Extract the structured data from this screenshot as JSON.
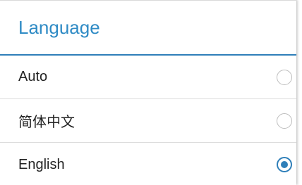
{
  "dialog": {
    "title": "Language",
    "accent_color": "#2f7fb9",
    "options": [
      {
        "label": "Auto",
        "selected": false
      },
      {
        "label": "简体中文",
        "selected": false
      },
      {
        "label": "English",
        "selected": true
      }
    ]
  }
}
